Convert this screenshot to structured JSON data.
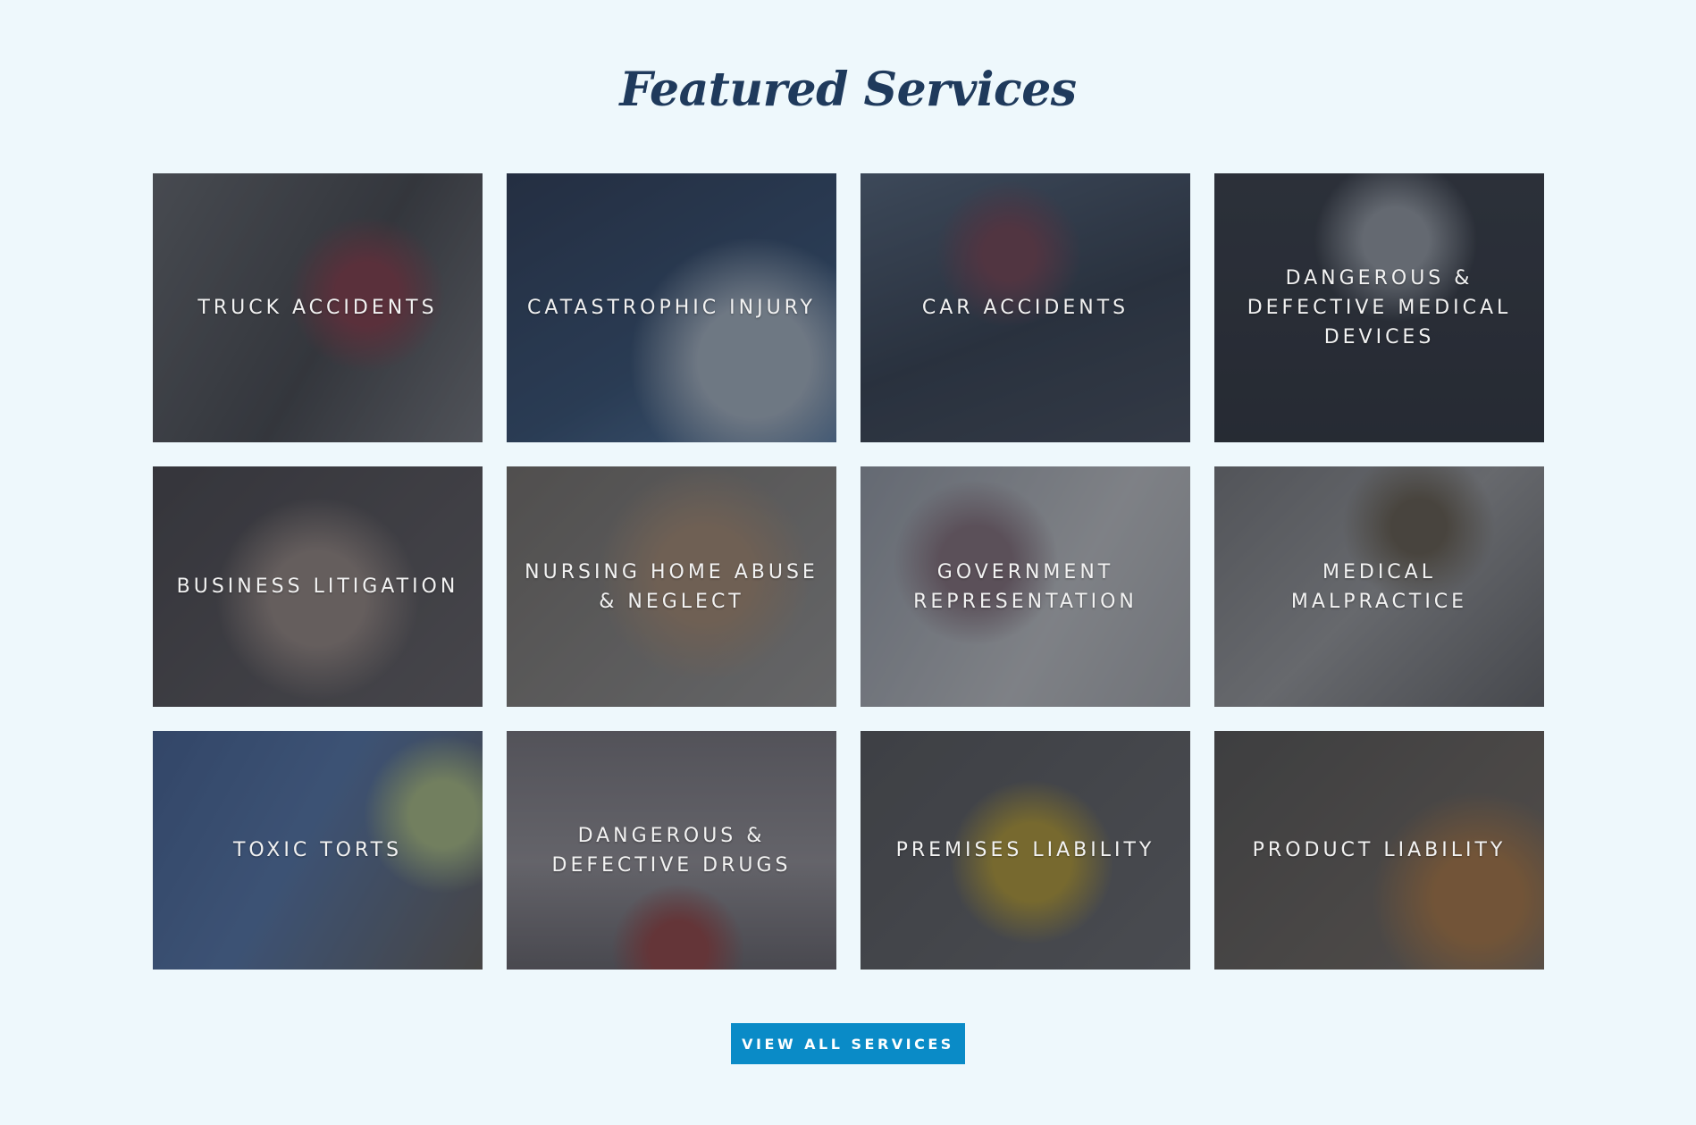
{
  "section": {
    "title": "Featured Services"
  },
  "services": [
    {
      "label": "TRUCK ACCIDENTS"
    },
    {
      "label": "CATASTROPHIC INJURY"
    },
    {
      "label": "CAR ACCIDENTS"
    },
    {
      "label": "DANGEROUS &\nDEFECTIVE MEDICAL\nDEVICES"
    },
    {
      "label": "BUSINESS LITIGATION"
    },
    {
      "label": "NURSING HOME ABUSE\n& NEGLECT"
    },
    {
      "label": "GOVERNMENT\nREPRESENTATION"
    },
    {
      "label": "MEDICAL\nMALPRACTICE"
    },
    {
      "label": "TOXIC TORTS"
    },
    {
      "label": "DANGEROUS &\nDEFECTIVE DRUGS"
    },
    {
      "label": "PREMISES LIABILITY"
    },
    {
      "label": "PRODUCT LIABILITY"
    }
  ],
  "cta": {
    "label": "VIEW ALL SERVICES"
  },
  "colors": {
    "background": "#eef8fc",
    "title": "#1f3a5c",
    "button": "#0a8bc7"
  }
}
